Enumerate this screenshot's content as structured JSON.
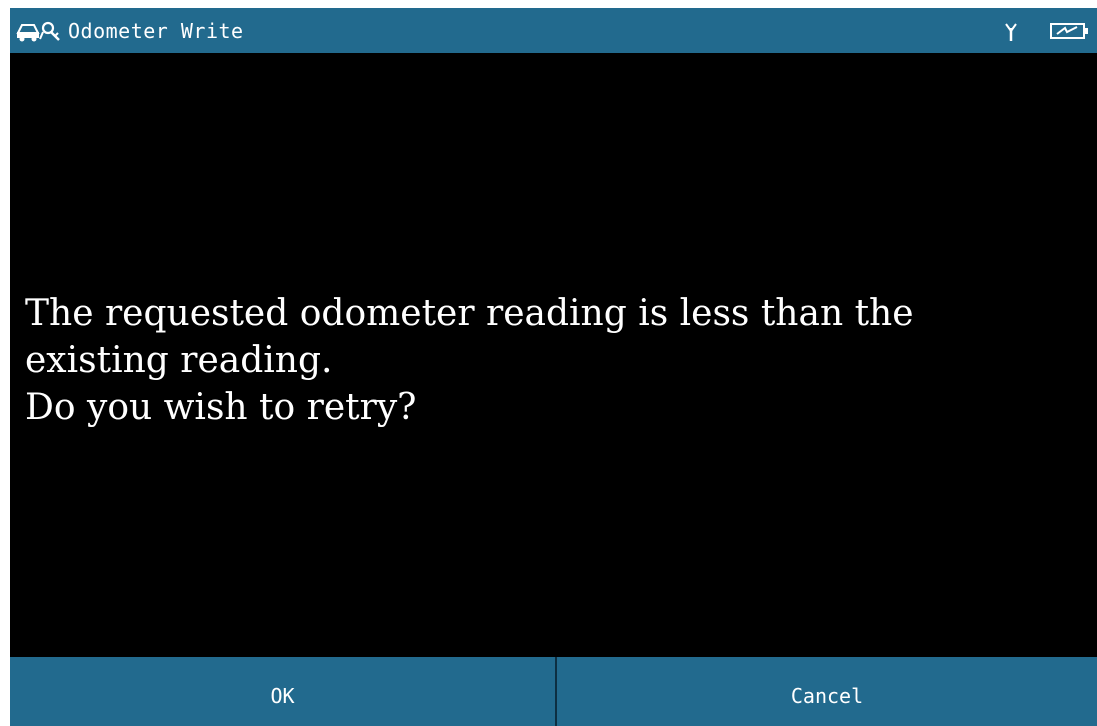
{
  "app": {
    "title": "Odometer Write",
    "icon": "car-key-icon",
    "status_icons": [
      "antenna-signal-icon",
      "battery-charging-icon"
    ]
  },
  "dialog": {
    "lines": [
      "The requested odometer reading is less than the",
      "existing reading.",
      "Do you wish to retry?"
    ]
  },
  "buttons": {
    "ok_label": "OK",
    "cancel_label": "Cancel"
  },
  "colors": {
    "bar": "#226a8e",
    "background": "#000000",
    "text": "#ffffff"
  }
}
